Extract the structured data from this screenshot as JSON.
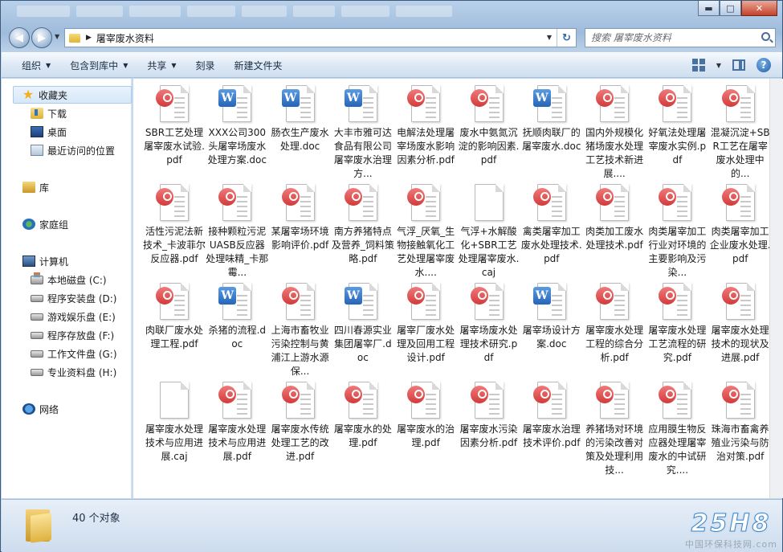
{
  "address": {
    "crumb": "屠宰废水资料",
    "arrow": "▶"
  },
  "search": {
    "placeholder": "搜索 屠宰废水资料"
  },
  "window_buttons": {
    "minimize": "▬",
    "maximize": "□",
    "close": "✕"
  },
  "toolbar": {
    "organize": "组织",
    "include_in_library": "包含到库中",
    "share": "共享",
    "burn": "刻录",
    "new_folder": "新建文件夹"
  },
  "sidebar": {
    "favorites": "收藏夹",
    "downloads": "下载",
    "desktop": "桌面",
    "recent": "最近访问的位置",
    "libraries": "库",
    "homegroup": "家庭组",
    "computer": "计算机",
    "drives": [
      "本地磁盘 (C:)",
      "程序安装盘 (D:)",
      "游戏娱乐盘 (E:)",
      "程序存放盘 (F:)",
      "工作文件盘 (G:)",
      "专业资料盘 (H:)"
    ],
    "network": "网络"
  },
  "files": [
    {
      "name": "SBR工艺处理屠宰废水试验.pdf",
      "type": "pdf"
    },
    {
      "name": "XXX公司300头屠宰场废水处理方案.doc",
      "type": "doc"
    },
    {
      "name": "肠衣生产废水处理.doc",
      "type": "doc"
    },
    {
      "name": "大丰市雅可达食品有限公司屠宰废水治理方...",
      "type": "doc"
    },
    {
      "name": "电解法处理屠宰场废水影响因素分析.pdf",
      "type": "pdf"
    },
    {
      "name": "废水中氨氮沉淀的影响因素.pdf",
      "type": "pdf"
    },
    {
      "name": "抚顺肉联厂的屠宰废水.doc",
      "type": "doc"
    },
    {
      "name": "国内外规模化猪场废水处理工艺技术新进展....",
      "type": "pdf"
    },
    {
      "name": "好氧法处理屠宰废水实例.pdf",
      "type": "pdf"
    },
    {
      "name": "混凝沉淀+SBR工艺在屠宰废水处理中的...",
      "type": "pdf"
    },
    {
      "name": "活性污泥法新技术_卡波菲尔反应器.pdf",
      "type": "pdf"
    },
    {
      "name": "接种颗粒污泥UASB反应器处理味精_卡那霉...",
      "type": "pdf"
    },
    {
      "name": "某屠宰场环境影响评价.pdf",
      "type": "pdf"
    },
    {
      "name": "南方养猪特点及营养_饲料策略.pdf",
      "type": "pdf"
    },
    {
      "name": "气浮_厌氧_生物接触氧化工艺处理屠宰废水....",
      "type": "pdf"
    },
    {
      "name": "气浮+水解酸化+SBR工艺处理屠宰废水.caj",
      "type": "caj"
    },
    {
      "name": "禽类屠宰加工废水处理技术.pdf",
      "type": "pdf"
    },
    {
      "name": "肉类加工废水处理技术.pdf",
      "type": "pdf"
    },
    {
      "name": "肉类屠宰加工行业对环境的主要影响及污染...",
      "type": "pdf"
    },
    {
      "name": "肉类屠宰加工企业废水处理.pdf",
      "type": "pdf"
    },
    {
      "name": "肉联厂废水处理工程.pdf",
      "type": "pdf"
    },
    {
      "name": "杀猪的流程.doc",
      "type": "doc"
    },
    {
      "name": "上海市畜牧业污染控制与黄浦江上游水源保...",
      "type": "pdf"
    },
    {
      "name": "四川春源实业集团屠宰厂.doc",
      "type": "doc"
    },
    {
      "name": "屠宰厂废水处理及回用工程设计.pdf",
      "type": "pdf"
    },
    {
      "name": "屠宰场废水处理技术研究.pdf",
      "type": "pdf"
    },
    {
      "name": "屠宰场设计方案.doc",
      "type": "doc"
    },
    {
      "name": "屠宰废水处理工程的综合分析.pdf",
      "type": "pdf"
    },
    {
      "name": "屠宰废水处理工艺流程的研究.pdf",
      "type": "pdf"
    },
    {
      "name": "屠宰废水处理技术的现状及进展.pdf",
      "type": "pdf"
    },
    {
      "name": "屠宰废水处理技术与应用进展.caj",
      "type": "caj"
    },
    {
      "name": "屠宰废水处理技术与应用进展.pdf",
      "type": "pdf"
    },
    {
      "name": "屠宰废水传统处理工艺的改进.pdf",
      "type": "pdf"
    },
    {
      "name": "屠宰废水的处理.pdf",
      "type": "pdf"
    },
    {
      "name": "屠宰废水的治理.pdf",
      "type": "pdf"
    },
    {
      "name": "屠宰废水污染因素分析.pdf",
      "type": "pdf"
    },
    {
      "name": "屠宰废水治理技术评价.pdf",
      "type": "pdf"
    },
    {
      "name": "养猪场对环境的污染改善对策及处理利用技...",
      "type": "pdf"
    },
    {
      "name": "应用膜生物反应器处理屠宰废水的中试研究....",
      "type": "pdf"
    },
    {
      "name": "珠海市畜禽养殖业污染与防治对策.pdf",
      "type": "pdf"
    }
  ],
  "status": {
    "count": "40 个对象"
  },
  "watermark": {
    "logo": "25H8",
    "site": "中国环保科技网.com"
  }
}
